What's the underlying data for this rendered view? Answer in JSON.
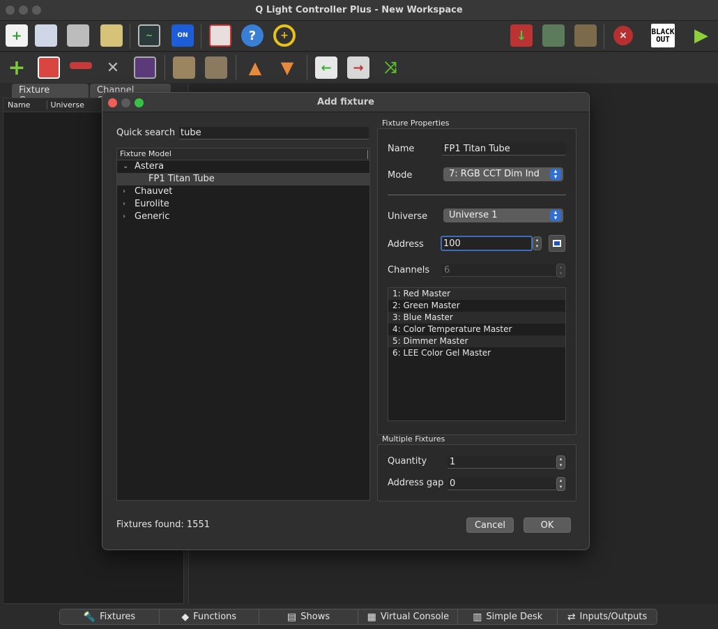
{
  "app": {
    "title": "Q Light Controller Plus - New Workspace"
  },
  "toolbar_right": {
    "blackout_line1": "BLACK",
    "blackout_line2": "OUT"
  },
  "left_panel": {
    "tabs": [
      "Fixture Groups",
      "Channel Groups"
    ],
    "columns": [
      "Name",
      "Universe"
    ]
  },
  "bottom_tabs": [
    "Fixtures",
    "Functions",
    "Shows",
    "Virtual Console",
    "Simple Desk",
    "Inputs/Outputs"
  ],
  "dialog": {
    "title": "Add fixture",
    "quick_search_label": "Quick search",
    "quick_search_value": "tube",
    "tree_header": "Fixture Model",
    "tree": {
      "astera": "Astera",
      "astera_child": "FP1 Titan Tube",
      "chauvet": "Chauvet",
      "eurolite": "Eurolite",
      "generic": "Generic"
    },
    "fixtures_found": "Fixtures found: 1551",
    "props": {
      "group_title": "Fixture Properties",
      "name_label": "Name",
      "name_value": "FP1 Titan Tube",
      "mode_label": "Mode",
      "mode_value": "7: RGB CCT Dim Ind",
      "universe_label": "Universe",
      "universe_value": "Universe 1",
      "address_label": "Address",
      "address_value": "100",
      "channels_label": "Channels",
      "channels_value": "6",
      "channel_list": [
        "1: Red Master",
        "2: Green Master",
        "3: Blue Master",
        "4: Color Temperature Master",
        "5: Dimmer Master",
        "6: LEE Color Gel Master"
      ]
    },
    "multiple": {
      "group_title": "Multiple Fixtures",
      "quantity_label": "Quantity",
      "quantity_value": "1",
      "gap_label": "Address gap",
      "gap_value": "0"
    },
    "cancel_label": "Cancel",
    "ok_label": "OK"
  }
}
